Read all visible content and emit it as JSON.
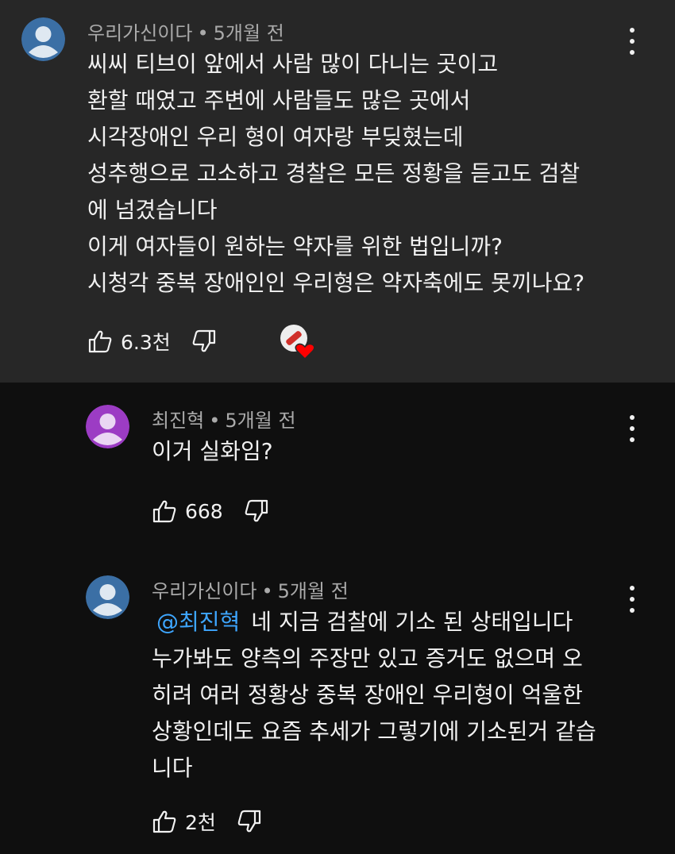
{
  "colors": {
    "highlight_bg": "#272727",
    "page_bg": "#0f0f0f",
    "mention": "#3ea6ff",
    "meta_text": "#aaaaaa",
    "avatar_blue": "#3b6fa5",
    "avatar_purple": "#9c3cc4"
  },
  "comments": [
    {
      "author": "우리가신이다",
      "separator": "•",
      "time": "5개월 전",
      "avatar_icon": "default-avatar-icon",
      "lines": [
        "씨씨 티브이 앞에서 사람 많이 다니는 곳이고",
        "환할 때였고 주변에 사람들도 많은 곳에서",
        "시각장애인 우리 형이 여자랑 부딪혔는데",
        "성추행으로 고소하고 경찰은 모든 정황을 듣고도 검찰",
        "에 넘겼습니다",
        "이게 여자들이 원하는 약자를 위한 법입니까?",
        "시청각 중복 장애인인 우리형은 약자축에도 못끼나요?"
      ],
      "likes": "6.3천",
      "creator_heart": true
    },
    {
      "author": "최진혁",
      "separator": "•",
      "time": "5개월 전",
      "avatar_icon": "default-avatar-icon",
      "lines": [
        "이거 실화임?"
      ],
      "likes": "668"
    },
    {
      "author": "우리가신이다",
      "separator": "•",
      "time": "5개월 전",
      "avatar_icon": "default-avatar-icon",
      "mention": "@최진혁",
      "first_line_text": "네 지금 검찰에 기소 된 상태입니다",
      "lines": [
        "누가봐도 양측의 주장만 있고 증거도 없으며 오",
        "히려 여러 정황상 중복 장애인 우리형이 억울한",
        "상황인데도 요즘 추세가 그렇기에 기소된거 같습",
        "니다"
      ],
      "likes": "2천"
    }
  ]
}
